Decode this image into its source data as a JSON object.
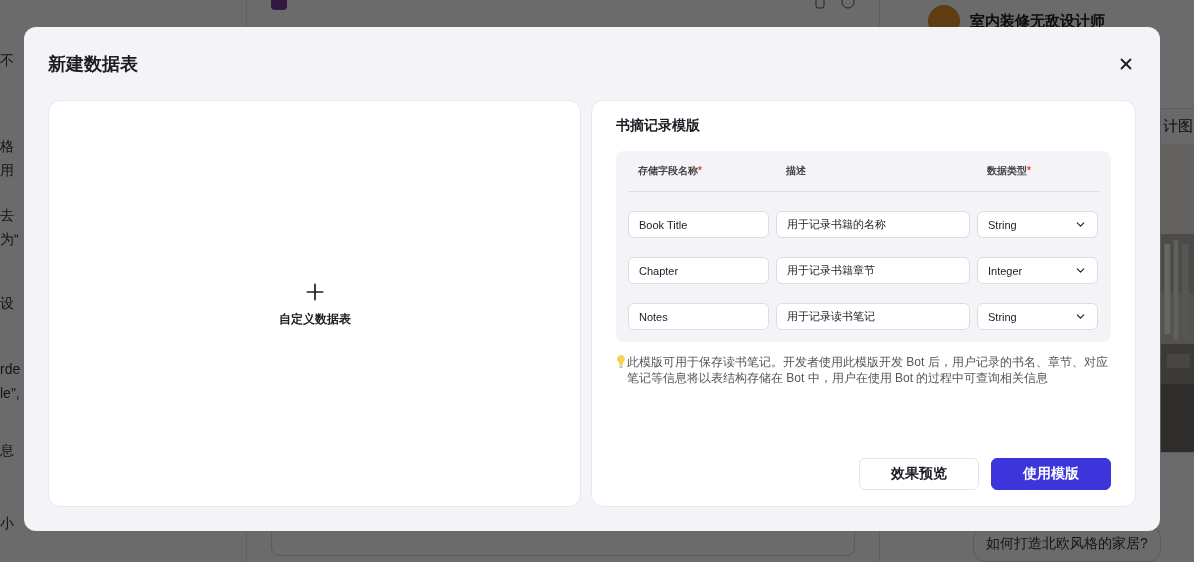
{
  "background": {
    "left_fragments": [
      "不",
      "格",
      "用",
      "去",
      "为“",
      "设",
      "rde",
      "le\",",
      "息",
      "小"
    ],
    "header": {
      "author": "室内装修无敌设计师"
    },
    "card": {
      "fragment": "计图"
    },
    "suggestion": "如何打造北欧风格的家居?"
  },
  "dialog": {
    "title": "新建数据表",
    "custom": {
      "label": "自定义数据表"
    },
    "template": {
      "title": "书摘记录模版",
      "required_mark": "*",
      "columns": [
        {
          "label": "存储字段名称",
          "required": true
        },
        {
          "label": "描述",
          "required": false
        },
        {
          "label": "数据类型",
          "required": true
        }
      ],
      "rows": [
        {
          "name": "Book Title",
          "description": "用于记录书籍的名称",
          "type": "String"
        },
        {
          "name": "Chapter",
          "description": "用于记录书籍章节",
          "type": "Integer"
        },
        {
          "name": "Notes",
          "description": "用于记录读书笔记",
          "type": "String"
        }
      ],
      "note": "此模版可用于保存读书笔记。开发者使用此模版开发 Bot 后，用户记录的书名、章节、对应笔记等信息将以表结构存储在 Bot 中，用户在使用 Bot 的过程中可查询相关信息",
      "buttons": [
        {
          "label": "效果预览",
          "kind": "secondary"
        },
        {
          "label": "使用模版",
          "kind": "primary"
        }
      ]
    }
  }
}
